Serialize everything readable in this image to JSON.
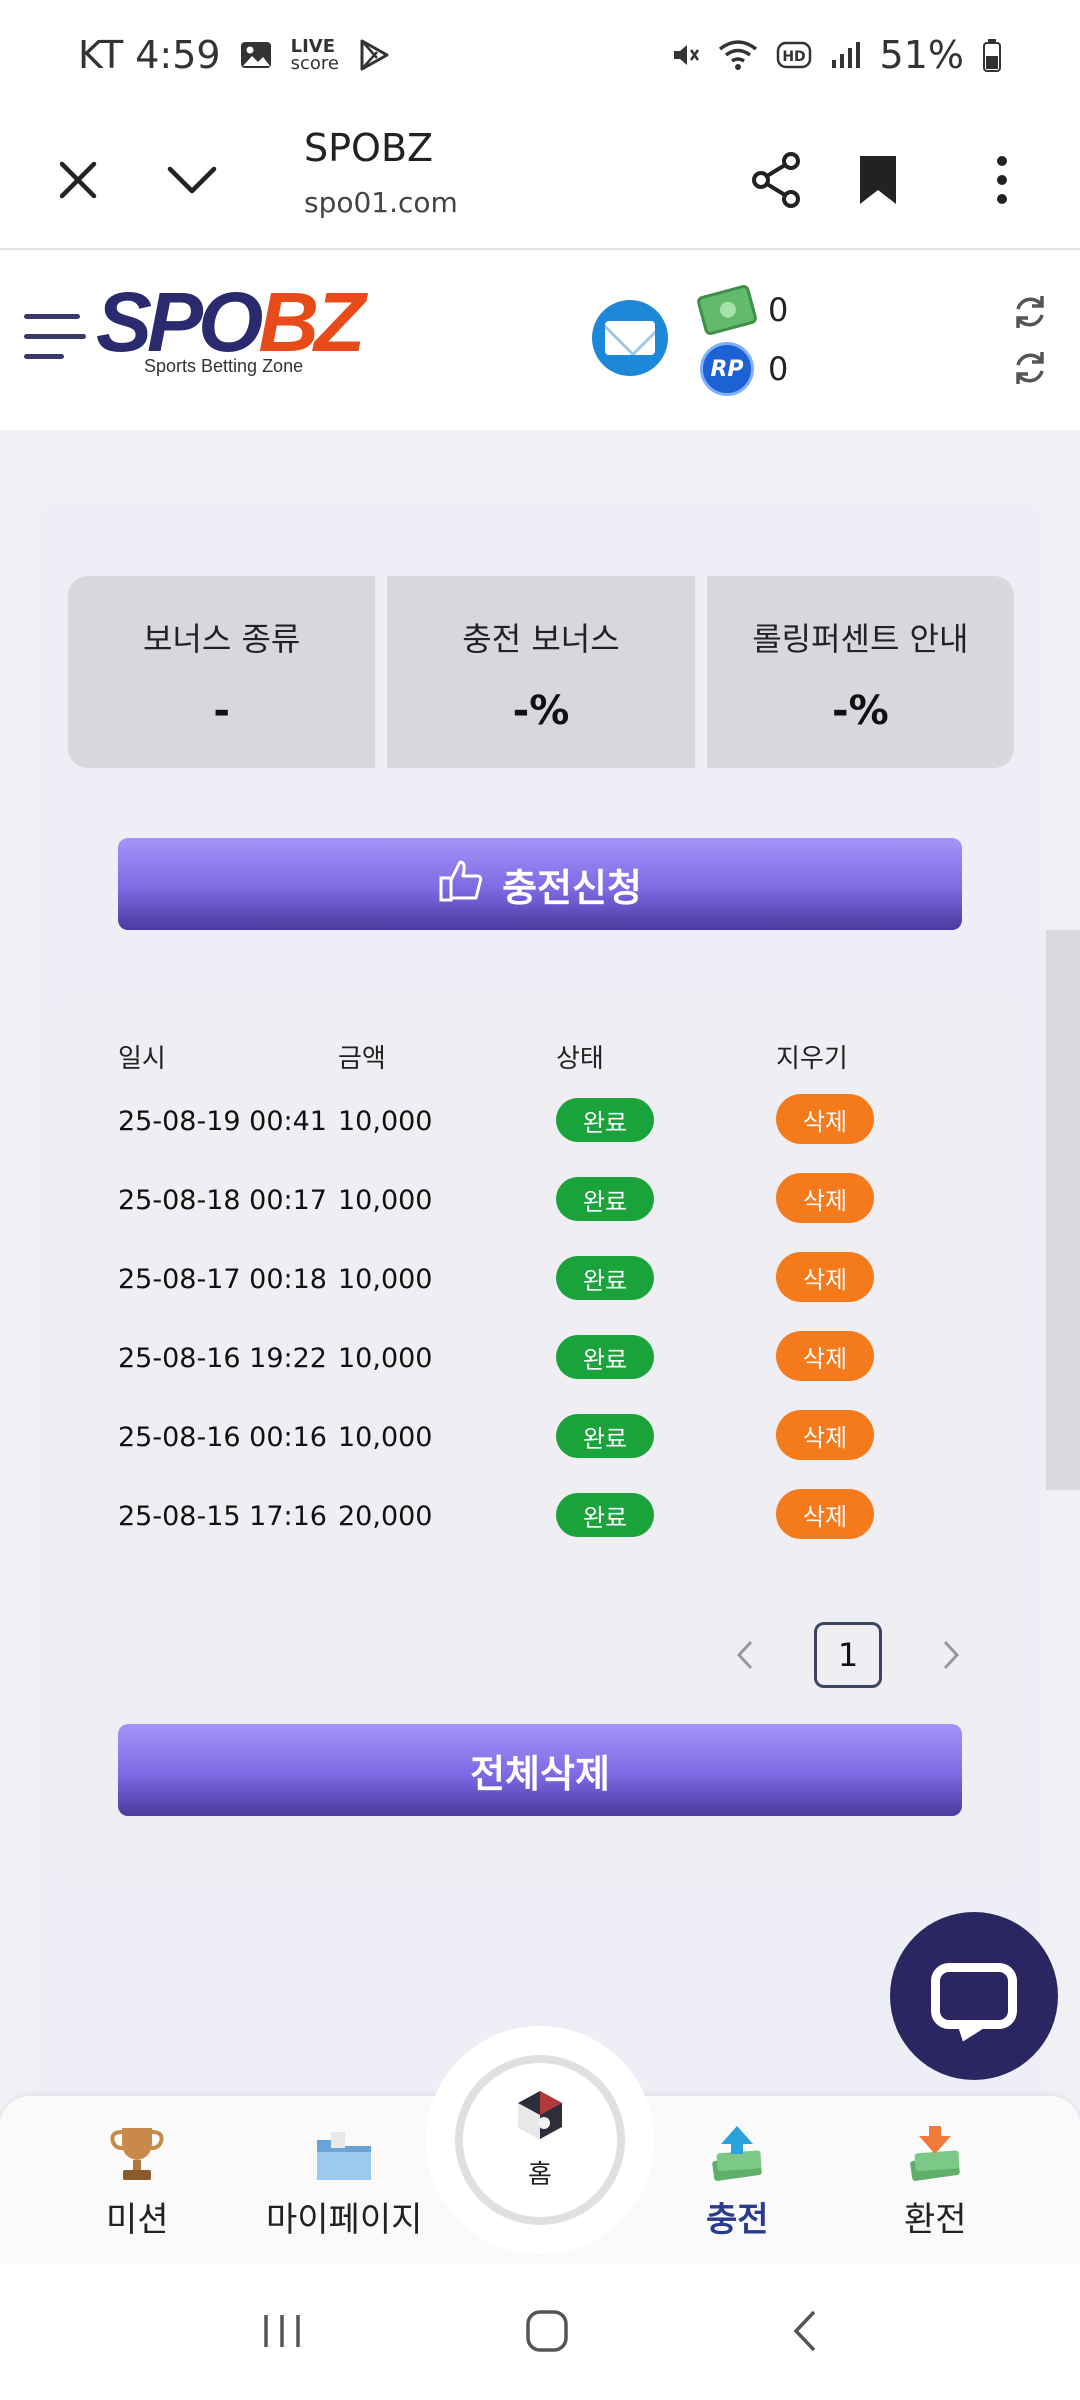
{
  "status_bar": {
    "carrier_time": "KT 4:59",
    "live_score_line1": "LIVE",
    "live_score_line2": "score",
    "battery": "51%"
  },
  "browser": {
    "title": "SPOBZ",
    "url": "spo01.com"
  },
  "header": {
    "logo_part1": "SPO",
    "logo_part2": "BZ",
    "logo_tagline": "Sports Betting Zone",
    "cash_amount": "0",
    "rp_label": "RP",
    "rp_amount": "0"
  },
  "bonus": [
    {
      "label": "보너스 종류",
      "value": "-"
    },
    {
      "label": "충전 보너스",
      "value": "-%"
    },
    {
      "label": "롤링퍼센트 안내",
      "value": "-%"
    }
  ],
  "apply_button": "충전신청",
  "history": {
    "headers": [
      "일시",
      "금액",
      "상태",
      "지우기"
    ],
    "rows": [
      {
        "date": "25-08-19 00:41",
        "amount": "10,000",
        "status": "완료",
        "delete": "삭제"
      },
      {
        "date": "25-08-18 00:17",
        "amount": "10,000",
        "status": "완료",
        "delete": "삭제"
      },
      {
        "date": "25-08-17 00:18",
        "amount": "10,000",
        "status": "완료",
        "delete": "삭제"
      },
      {
        "date": "25-08-16 19:22",
        "amount": "10,000",
        "status": "완료",
        "delete": "삭제"
      },
      {
        "date": "25-08-16 00:16",
        "amount": "10,000",
        "status": "완료",
        "delete": "삭제"
      },
      {
        "date": "25-08-15 17:16",
        "amount": "20,000",
        "status": "완료",
        "delete": "삭제"
      }
    ]
  },
  "pagination": {
    "current": "1"
  },
  "delete_all_button": "전체삭제",
  "bottom_nav": {
    "mission": "미션",
    "mypage": "마이페이지",
    "home": "홈",
    "charge": "충전",
    "exchange": "환전"
  },
  "colors": {
    "brand_navy": "#2a2a6e",
    "brand_orange": "#e84b1a",
    "button_purple": "#7e6ae3",
    "status_green": "#1aa33b",
    "delete_orange": "#f57a1c",
    "chat_navy": "#2b2562"
  }
}
